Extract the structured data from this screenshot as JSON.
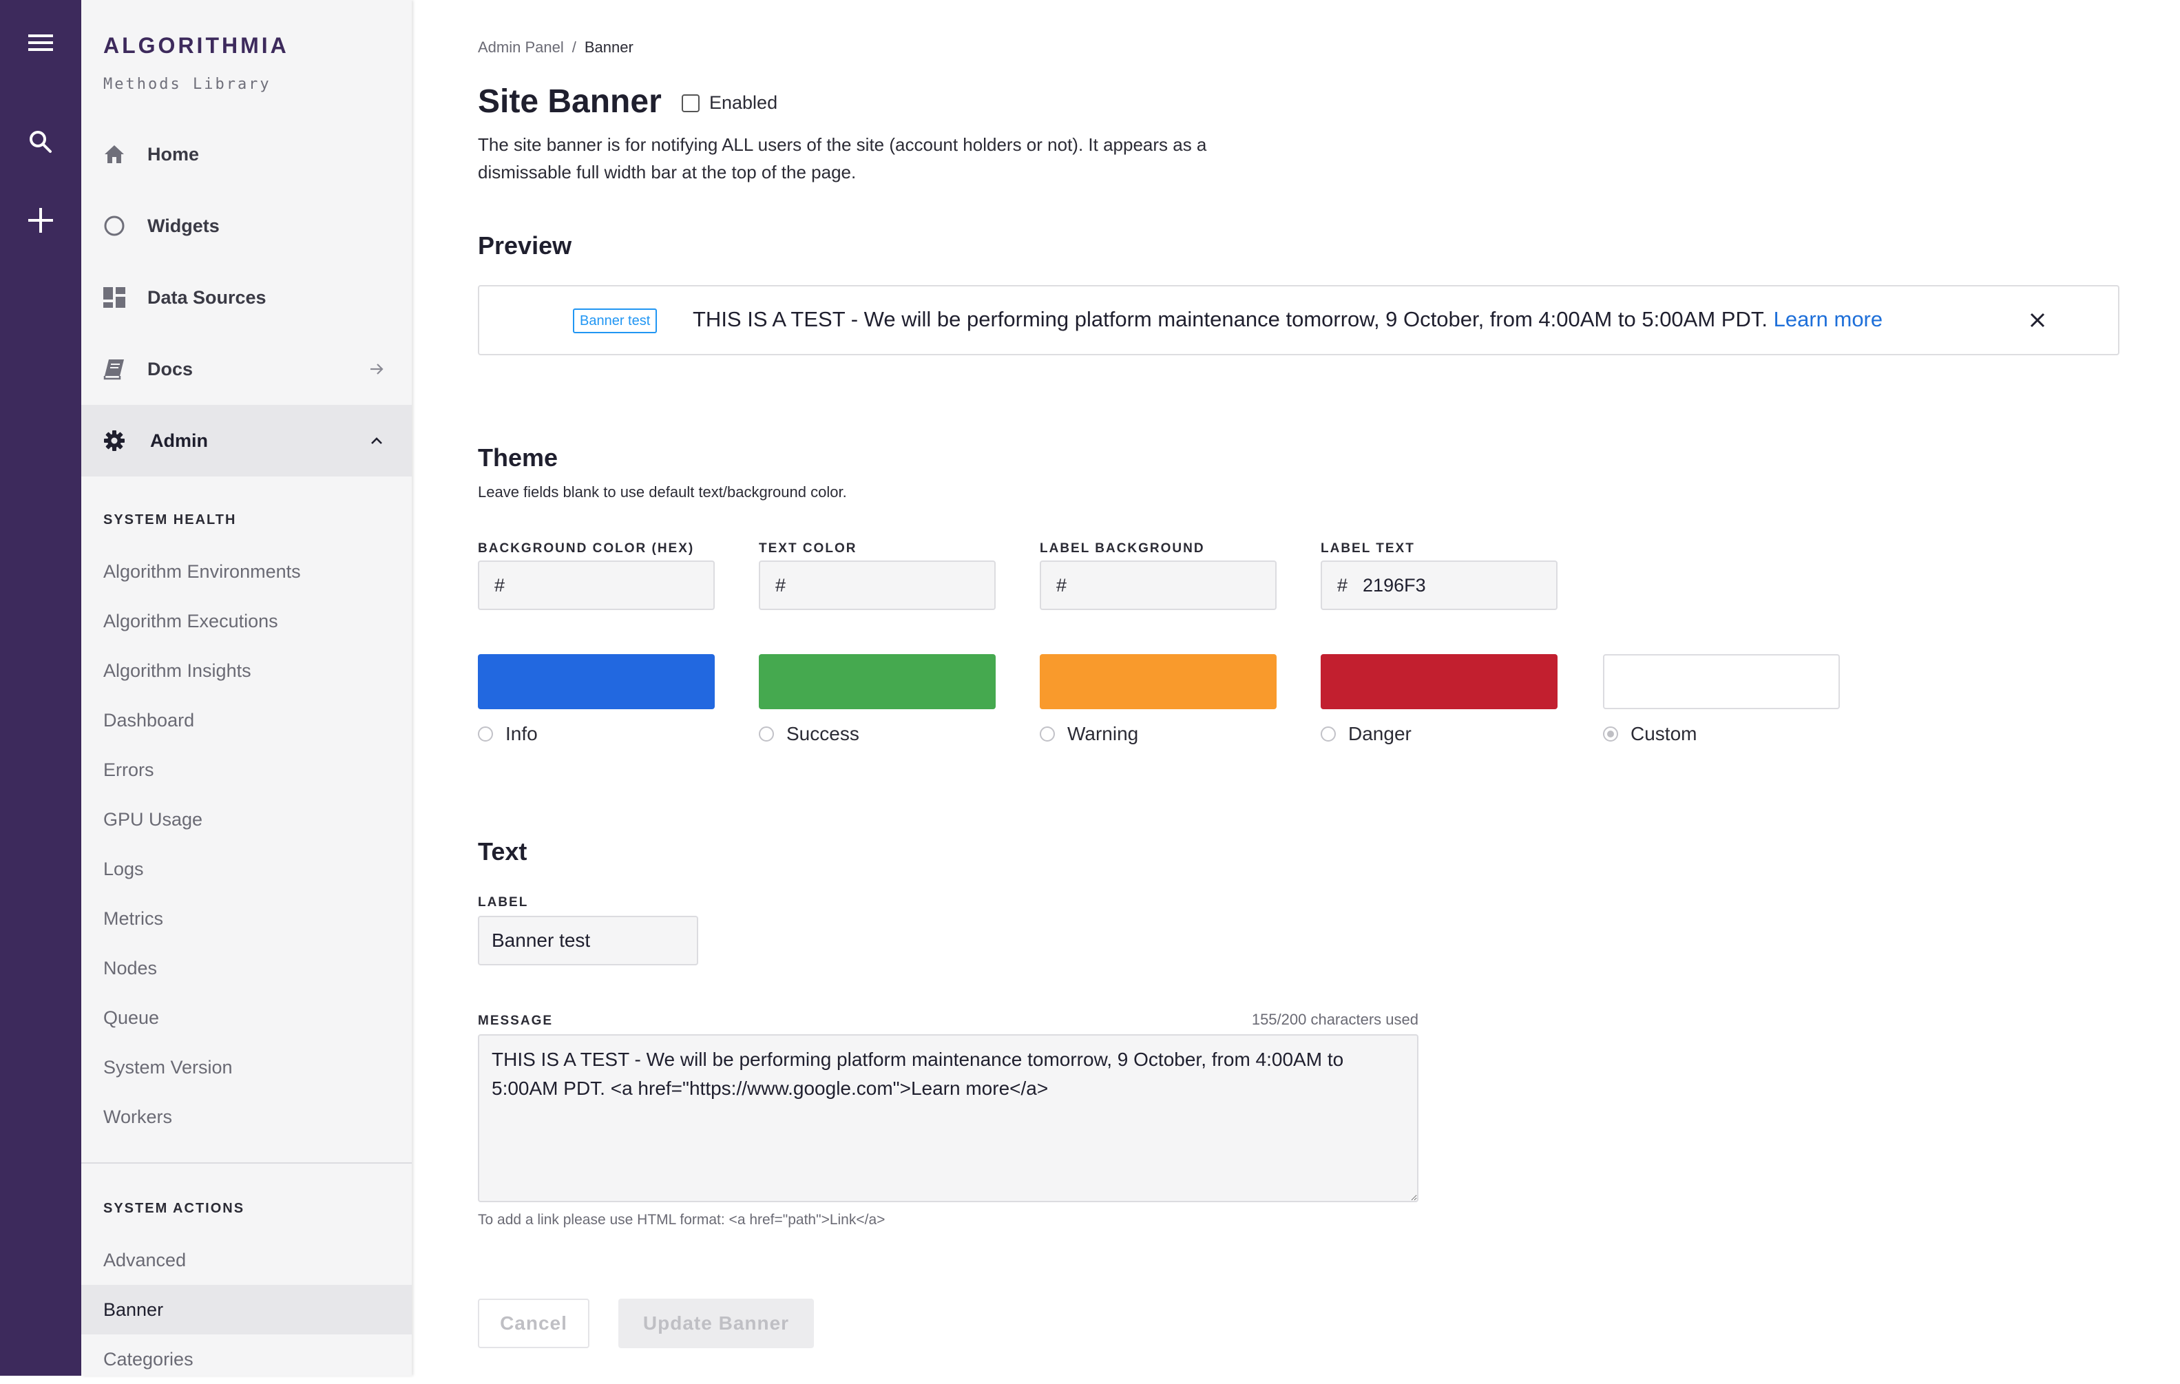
{
  "brand": {
    "name": "ALGORITHMIA",
    "subtitle": "Methods Library"
  },
  "rail": {
    "icons": [
      "hamburger-icon",
      "search-icon",
      "plus-icon"
    ]
  },
  "sidebar": {
    "nav": [
      {
        "label": "Home",
        "icon": "home-icon"
      },
      {
        "label": "Widgets",
        "icon": "circle-icon"
      },
      {
        "label": "Data Sources",
        "icon": "dashboard-icon"
      },
      {
        "label": "Docs",
        "icon": "book-icon"
      },
      {
        "label": "Admin",
        "icon": "gear-icon"
      }
    ],
    "system_health": {
      "heading": "SYSTEM HEALTH",
      "items": [
        "Algorithm Environments",
        "Algorithm Executions",
        "Algorithm Insights",
        "Dashboard",
        "Errors",
        "GPU Usage",
        "Logs",
        "Metrics",
        "Nodes",
        "Queue",
        "System Version",
        "Workers"
      ]
    },
    "system_actions": {
      "heading": "SYSTEM ACTIONS",
      "items": [
        "Advanced",
        "Banner",
        "Categories"
      ],
      "active": "Banner"
    }
  },
  "breadcrumb": {
    "parent": "Admin Panel",
    "separator": "/",
    "current": "Banner"
  },
  "page": {
    "title": "Site Banner",
    "enabled_label": "Enabled",
    "enabled": false,
    "description": "The site banner is for notifying ALL users of the site (account holders or not). It appears as a dismissable full width bar at the top of the page."
  },
  "preview": {
    "heading": "Preview",
    "label": "Banner test",
    "message": "THIS IS A TEST - We will be performing platform maintenance tomorrow, 9 October, from 4:00AM to 5:00AM PDT.",
    "link_text": "Learn more",
    "label_color": "#2196F3",
    "link_color": "#1E6FD9"
  },
  "theme": {
    "heading": "Theme",
    "note": "Leave fields blank to use default text/background color.",
    "fields": [
      {
        "label": "BACKGROUND COLOR (HEX)",
        "prefix": "#",
        "value": ""
      },
      {
        "label": "TEXT COLOR",
        "prefix": "#",
        "value": ""
      },
      {
        "label": "LABEL BACKGROUND",
        "prefix": "#",
        "value": ""
      },
      {
        "label": "LABEL TEXT",
        "prefix": "#",
        "value": "2196F3"
      }
    ],
    "options": [
      {
        "label": "Info",
        "color": "#2268E0",
        "checked": false
      },
      {
        "label": "Success",
        "color": "#45A94F",
        "checked": false
      },
      {
        "label": "Warning",
        "color": "#F99A2C",
        "checked": false
      },
      {
        "label": "Danger",
        "color": "#C21F2F",
        "checked": false
      },
      {
        "label": "Custom",
        "color": "#FFFFFF",
        "checked": true
      }
    ]
  },
  "text": {
    "heading": "Text",
    "label_field": {
      "label": "LABEL",
      "value": "Banner test"
    },
    "message_field": {
      "label": "MESSAGE",
      "count": "155/200 characters used",
      "value": "THIS IS A TEST - We will be performing platform maintenance tomorrow, 9 October, from 4:00AM to 5:00AM PDT. <a href=\"https://www.google.com\">Learn more</a>",
      "hint": "To add a link please use HTML format: <a href=\"path\">Link</a>"
    }
  },
  "actions": {
    "cancel": "Cancel",
    "update": "Update Banner"
  }
}
